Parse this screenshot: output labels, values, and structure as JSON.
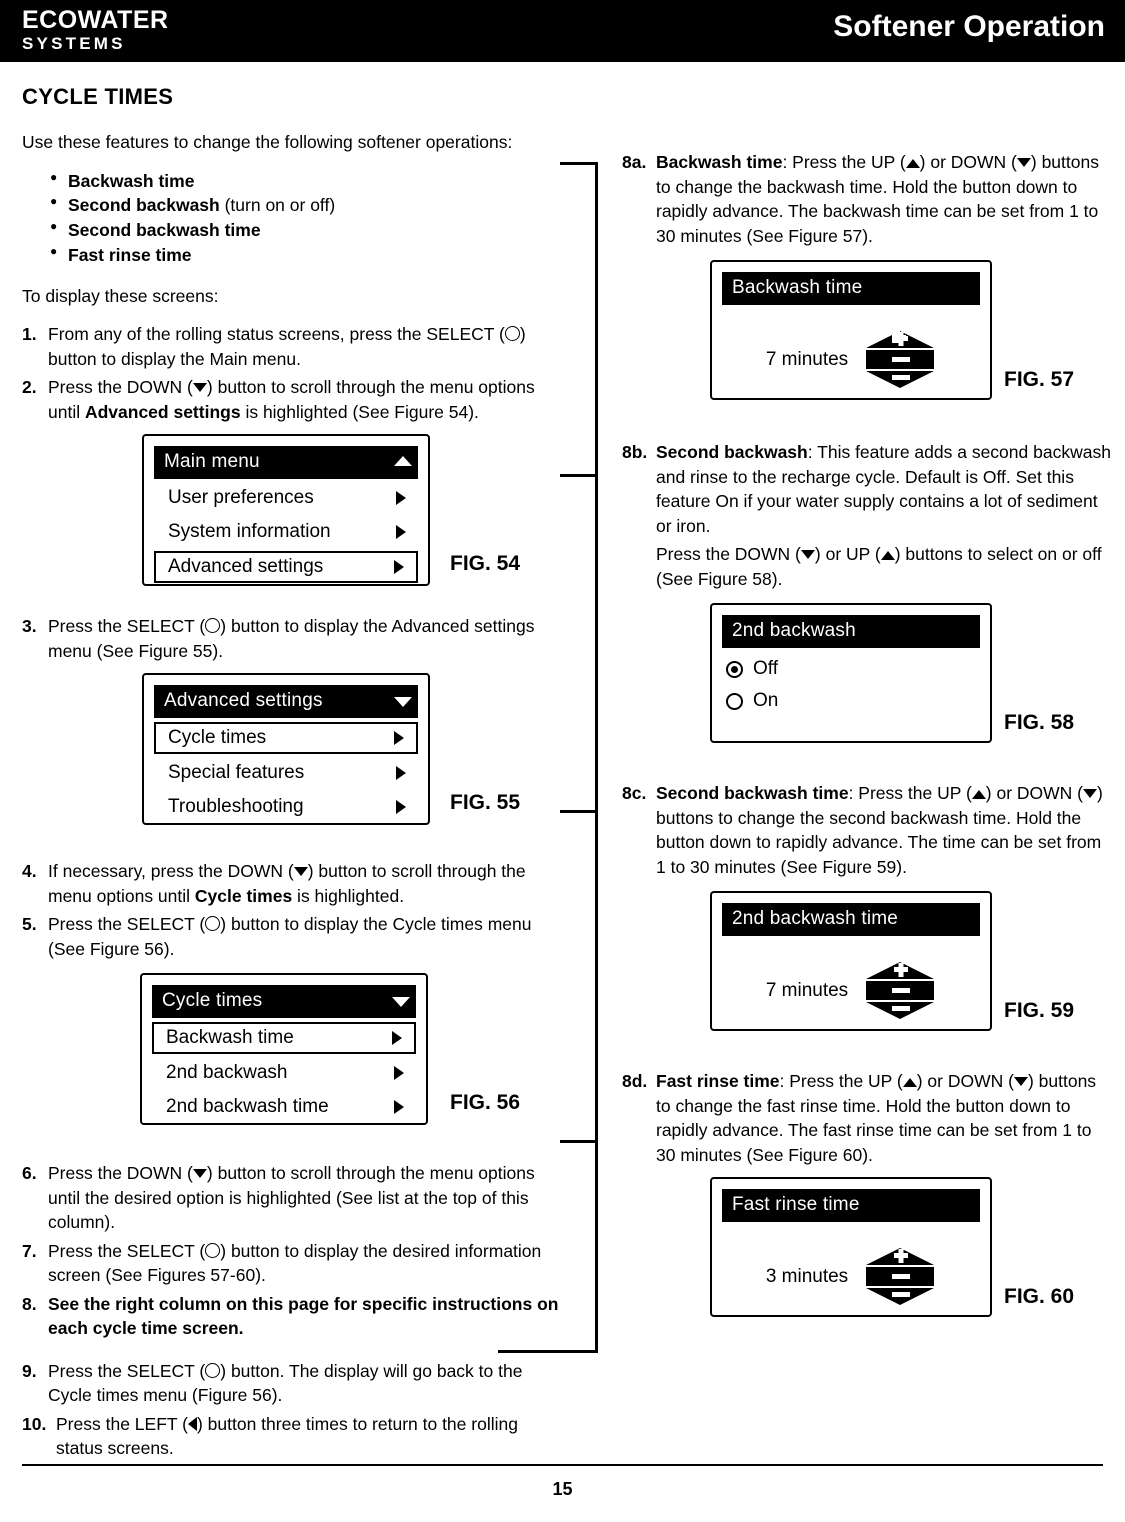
{
  "header": {
    "brand_line1": "ECOWATER",
    "brand_line2": "SYSTEMS",
    "title": "Softener Operation"
  },
  "left": {
    "section_title": "CYCLE TIMES",
    "intro": "Use these features to change the following softener operations:",
    "bullets": [
      {
        "bold": "Backwash time",
        "rest": ""
      },
      {
        "bold": "Second backwash",
        "rest": " (turn on or off)"
      },
      {
        "bold": "Second backwash time",
        "rest": ""
      },
      {
        "bold": "Fast rinse time",
        "rest": ""
      }
    ],
    "display_intro": "To display these screens:",
    "steps": [
      {
        "num": "1.",
        "text_a": "From any of the rolling status screens, press the SELECT (",
        "text_b": ") button to display the Main menu."
      },
      {
        "num": "2.",
        "text_a": "Press the DOWN (",
        "text_b": ") button to scroll through the menu options until ",
        "bold": "Advanced settings",
        "text_c": " is highlighted (See Figure 54)."
      },
      {
        "num": "3.",
        "text_a": "Press the SELECT (",
        "text_b": ") button to display the Advanced settings menu (See Figure 55)."
      },
      {
        "num": "4.",
        "text_a": "If necessary, press the DOWN (",
        "text_b": ") button to scroll through the menu options until ",
        "bold": "Cycle times",
        "text_c": " is highlighted."
      },
      {
        "num": "5.",
        "text_a": "Press the SELECT (",
        "text_b": ") button to display the Cycle times menu (See Figure 56)."
      },
      {
        "num": "6.",
        "text_a": "Press the DOWN (",
        "text_b": ") button to scroll through the menu options until the desired option is highlighted (See list at the top of this column)."
      },
      {
        "num": "7.",
        "text_a": "Press the SELECT (",
        "text_b": ") button to display the desired information screen (See Figures 57-60)."
      },
      {
        "num": "8.",
        "bold_all": "See the right column on this page for specific instructions on each cycle time screen."
      },
      {
        "num": "9.",
        "text_a": "Press the SELECT (",
        "text_b": ") button.  The display will go back to the Cycle times menu (Figure 56)."
      },
      {
        "num": "10.",
        "text_a": "Press the LEFT (",
        "text_b": ") button three times to return to the rolling status screens."
      }
    ],
    "fig54": {
      "title": "Main menu",
      "rows": [
        "User preferences",
        "System information",
        "Advanced settings"
      ],
      "label": "FIG. 54"
    },
    "fig55": {
      "title": "Advanced settings",
      "rows": [
        "Cycle times",
        "Special features",
        "Troubleshooting"
      ],
      "label": "FIG. 55"
    },
    "fig56": {
      "title": "Cycle times",
      "rows": [
        "Backwash time",
        "2nd backwash",
        "2nd backwash time"
      ],
      "label": "FIG. 56"
    }
  },
  "right": {
    "items": [
      {
        "num": "8a.",
        "bold": "Backwash time",
        "t1": ": Press the UP (",
        "t2": ") or DOWN (",
        "t3": ") buttons to change the backwash time.  Hold the button down to rapidly advance.  The backwash time can be set from 1 to 30 minutes (See Figure 57)."
      },
      {
        "num": "8b.",
        "bold": "Second backwash",
        "t1": ": This feature adds a second backwash and rinse to the recharge cycle.  Default is Off.  Set this feature On if your water supply contains a lot of sediment or iron.",
        "t2": "Press the DOWN (",
        "t3": ") or UP (",
        "t4": ") buttons to select on or off (See Figure 58)."
      },
      {
        "num": "8c.",
        "bold": "Second backwash time",
        "t1": ": Press the UP (",
        "t2": ") or DOWN (",
        "t3": ") buttons to change the second backwash time.  Hold the button down to rapidly advance.  The time can be set from 1 to 30 minutes (See Figure 59)."
      },
      {
        "num": "8d.",
        "bold": "Fast rinse time",
        "t1": ": Press the UP (",
        "t2": ") or DOWN (",
        "t3": ") buttons to change the fast rinse time.  Hold the button down to rapidly advance.  The fast rinse time can be set from 1 to 30 minutes (See Figure 60)."
      }
    ],
    "fig57": {
      "title": "Backwash time",
      "value": "7 minutes",
      "label": "FIG. 57"
    },
    "fig58": {
      "title": "2nd backwash",
      "option_off": "Off",
      "option_on": "On",
      "selected": "Off",
      "label": "FIG. 58"
    },
    "fig59": {
      "title": "2nd backwash time",
      "value": "7 minutes",
      "label": "FIG. 59"
    },
    "fig60": {
      "title": "Fast rinse time",
      "value": "3 minutes",
      "label": "FIG. 60"
    }
  },
  "footer": {
    "page_number": "15"
  }
}
